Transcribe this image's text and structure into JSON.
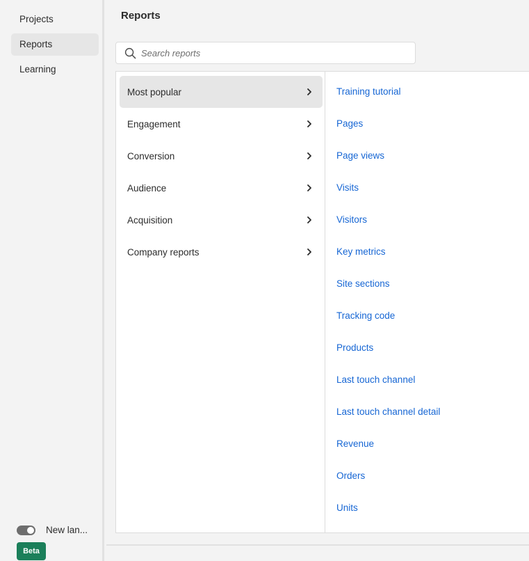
{
  "sidebar": {
    "items": [
      {
        "label": "Projects",
        "active": false
      },
      {
        "label": "Reports",
        "active": true
      },
      {
        "label": "Learning",
        "active": false
      }
    ],
    "toggle": {
      "label": "New lan...",
      "state": "on"
    },
    "badge": "Beta"
  },
  "header": {
    "title": "Reports"
  },
  "search": {
    "placeholder": "Search reports",
    "value": "",
    "icon": "search-icon"
  },
  "categories": [
    {
      "label": "Most popular",
      "active": true
    },
    {
      "label": "Engagement",
      "active": false
    },
    {
      "label": "Conversion",
      "active": false
    },
    {
      "label": "Audience",
      "active": false
    },
    {
      "label": "Acquisition",
      "active": false
    },
    {
      "label": "Company reports",
      "active": false
    }
  ],
  "reports": [
    "Training tutorial",
    "Pages",
    "Page views",
    "Visits",
    "Visitors",
    "Key metrics",
    "Site sections",
    "Tracking code",
    "Products",
    "Last touch channel",
    "Last touch channel detail",
    "Revenue",
    "Orders",
    "Units"
  ],
  "colors": {
    "link": "#1666d4",
    "badge": "#1b7f5a",
    "active_bg": "#e6e6e6"
  }
}
